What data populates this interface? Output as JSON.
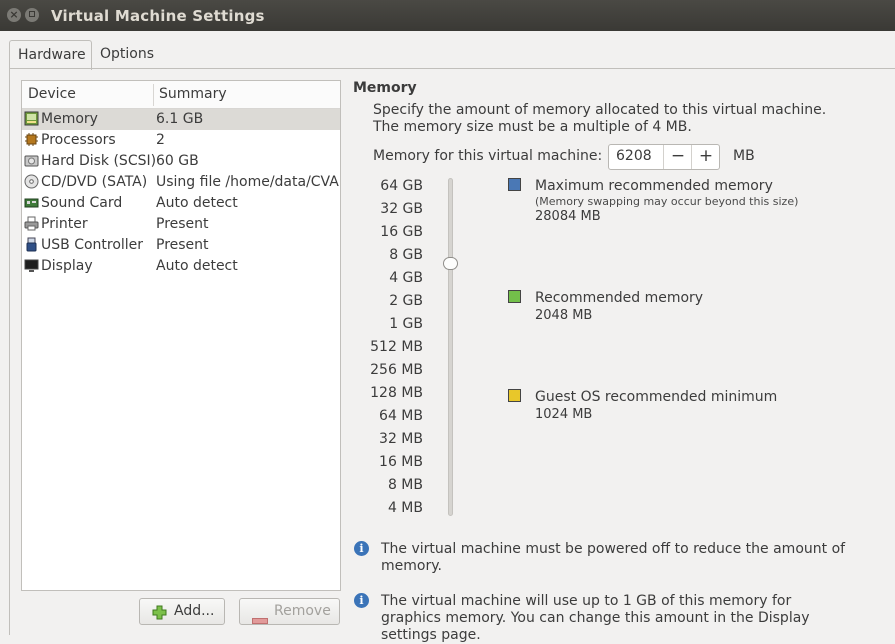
{
  "window": {
    "title": "Virtual Machine Settings",
    "close_icon": "close-icon",
    "minimize_icon": "minimize-icon"
  },
  "tabs": [
    {
      "label": "Hardware",
      "active": true
    },
    {
      "label": "Options",
      "active": false
    }
  ],
  "device_table": {
    "headers": {
      "device": "Device",
      "summary": "Summary"
    },
    "rows": [
      {
        "name": "Memory",
        "summary": "6.1 GB",
        "icon": "memory-icon",
        "selected": true
      },
      {
        "name": "Processors",
        "summary": "2",
        "icon": "processor-icon"
      },
      {
        "name": "Hard Disk (SCSI)",
        "summary": "60 GB",
        "icon": "hard-disk-icon"
      },
      {
        "name": "CD/DVD (SATA)",
        "summary": "Using file /home/data/CVA",
        "icon": "cd-dvd-icon"
      },
      {
        "name": "Sound Card",
        "summary": "Auto detect",
        "icon": "sound-card-icon"
      },
      {
        "name": "Printer",
        "summary": "Present",
        "icon": "printer-icon"
      },
      {
        "name": "USB Controller",
        "summary": "Present",
        "icon": "usb-icon"
      },
      {
        "name": "Display",
        "summary": "Auto detect",
        "icon": "display-icon"
      }
    ]
  },
  "buttons": {
    "add_label": "Add...",
    "remove_label": "Remove"
  },
  "memory": {
    "section_title": "Memory",
    "description": "Specify the amount of memory allocated to this virtual machine. The memory size must be a multiple of 4 MB.",
    "field_label": "Memory for this virtual machine:",
    "value": "6208",
    "decrement": "−",
    "increment": "+",
    "unit": "MB",
    "scale_labels": [
      "64 GB",
      "32 GB",
      "16 GB",
      "8 GB",
      "4 GB",
      "2 GB",
      "1 GB",
      "512 MB",
      "256 MB",
      "128 MB",
      "64 MB",
      "32 MB",
      "16 MB",
      "8 MB",
      "4 MB"
    ],
    "legend": [
      {
        "title": "Maximum recommended memory",
        "subtitle": "(Memory swapping may occur beyond this size)",
        "value": "28084 MB",
        "color": "#4a78b5"
      },
      {
        "title": "Recommended memory",
        "subtitle": "",
        "value": "2048 MB",
        "color": "#73c04a"
      },
      {
        "title": "Guest OS recommended minimum",
        "subtitle": "",
        "value": "1024 MB",
        "color": "#e8c72a"
      }
    ],
    "notes": [
      "The virtual machine must be powered off to reduce the amount of memory.",
      "The virtual machine will use up to 1 GB of this memory for graphics memory. You can change this amount in the Display settings page."
    ]
  }
}
